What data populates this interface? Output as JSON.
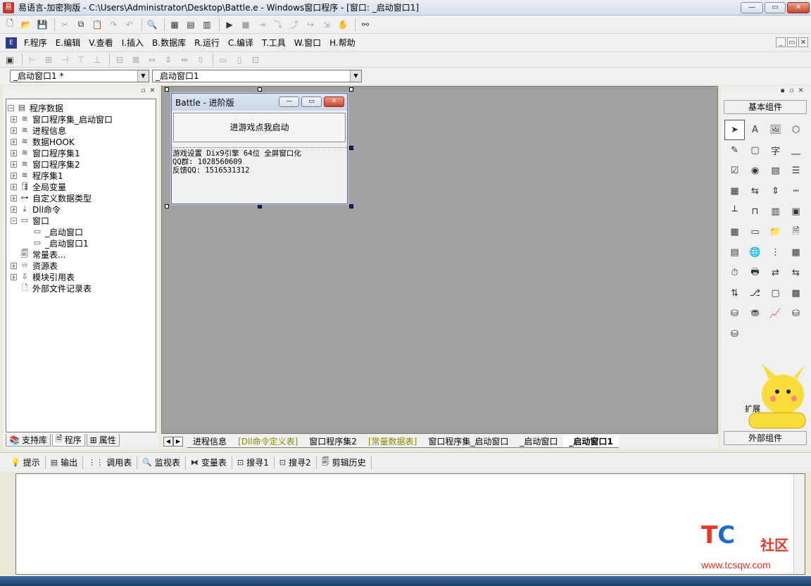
{
  "window": {
    "title": "易语言-加密狗版 - C:\\Users\\Administrator\\Desktop\\Battle.e - Windows窗口程序 - [窗口: _启动窗口1]"
  },
  "menu": {
    "items": [
      "F.程序",
      "E.编辑",
      "V.查看",
      "I.插入",
      "B.数据库",
      "R.运行",
      "C.编译",
      "T.工具",
      "W.窗口",
      "H.帮助"
    ]
  },
  "combos": {
    "left": "_启动窗口1 *",
    "right": "_启动窗口1"
  },
  "tree": {
    "root": "程序数据",
    "items": [
      "窗口程序集_启动窗口",
      "进程信息",
      "数据HOOK",
      "窗口程序集1",
      "窗口程序集2",
      "程序集1",
      "全局变量",
      "自定义数据类型",
      "Dll命令",
      "窗口",
      "_启动窗口",
      "_启动窗口1",
      "常量表...",
      "资源表",
      "模块引用表",
      "外部文件记录表"
    ]
  },
  "left_tabs": [
    "支持库",
    "程序",
    "属性"
  ],
  "form": {
    "title": "Battle - 进阶版",
    "button_label": "进游戏点我启动",
    "label_lines": [
      "游戏设置 Dix9引擎 64位 全屏窗口化",
      "QQ群: 1028560609",
      "反馈QQ: 1516531312"
    ]
  },
  "doc_tabs": [
    "进程信息",
    "[Dll命令定义表]",
    "窗口程序集2",
    "[常量数据表]",
    "窗口程序集_启动窗口",
    "_启动窗口",
    "_启动窗口1"
  ],
  "right_panel": {
    "basic_header": "基本组件",
    "ext_header": "外部组件",
    "ext_overlay_label": "扩展",
    "components": [
      "pointer",
      "label",
      "picture",
      "shape",
      "editbox",
      "image-box",
      "text-zi",
      "line",
      "checkbox",
      "radio",
      "group",
      "list",
      "combo",
      "slider",
      "spin",
      "hline",
      "ruler",
      "tabs",
      "vtabs",
      "toolbar",
      "grid",
      "button",
      "dir",
      "file",
      "table",
      "globe",
      "tree",
      "calendar",
      "timer",
      "printer",
      "link",
      "link2",
      "net",
      "pipe",
      "frame",
      "panel",
      "db",
      "db2",
      "chart",
      "odbc",
      "odbc2"
    ]
  },
  "bottom_tabs": [
    "提示",
    "输出",
    "调用表",
    "监视表",
    "变量表",
    "搜寻1",
    "搜寻2",
    "剪辑历史"
  ],
  "watermark": {
    "logo_t": "T",
    "logo_c": "C",
    "cn": "社区",
    "url": "www.tcsqw.com"
  }
}
